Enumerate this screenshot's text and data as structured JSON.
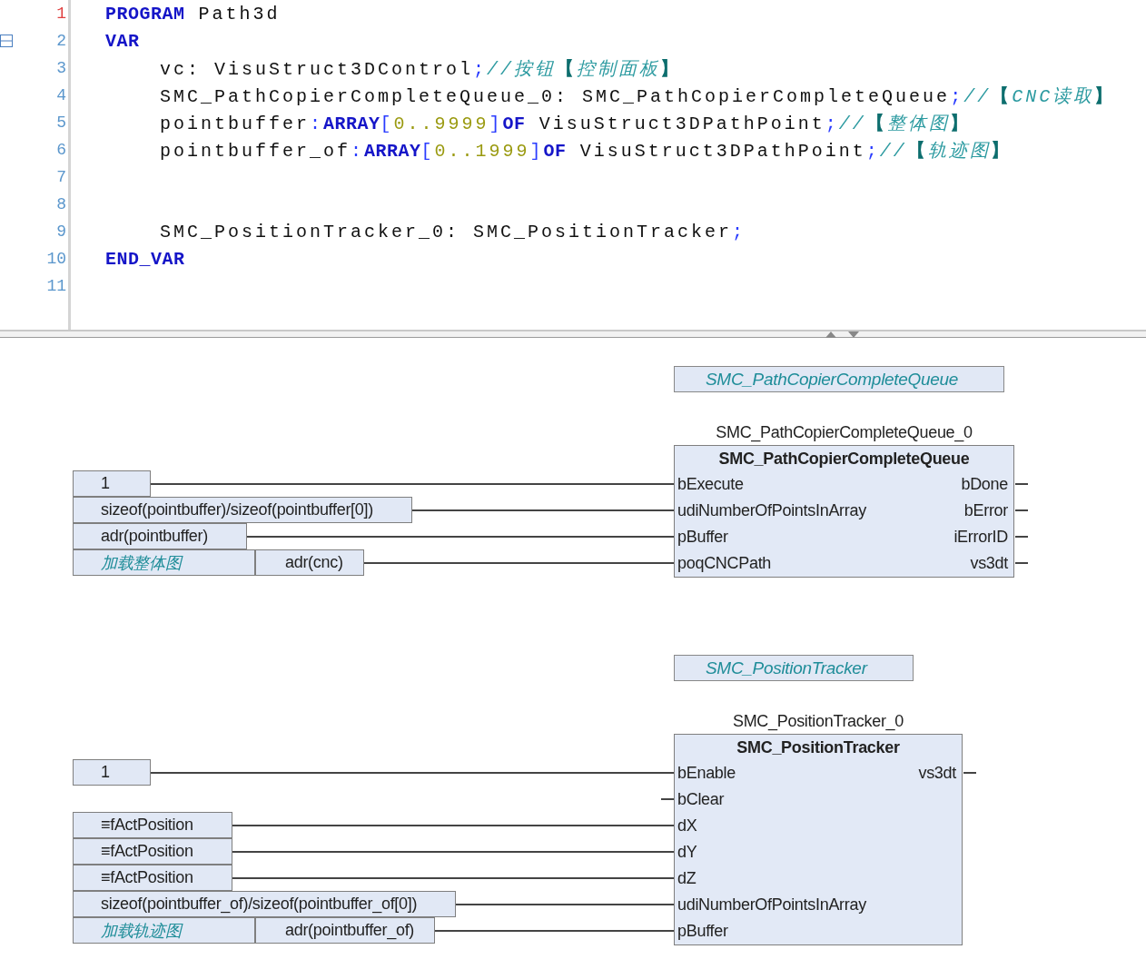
{
  "editor": {
    "lines": [
      {
        "number": "1",
        "current": true,
        "tokens": [
          {
            "kind": "keyword",
            "text": "PROGRAM"
          },
          {
            "kind": "text",
            "text": " Path3d"
          }
        ]
      },
      {
        "number": "2",
        "current": false,
        "expanded": true,
        "tokens": [
          {
            "kind": "keyword",
            "text": "VAR"
          }
        ],
        "children": [
          {
            "number": "3",
            "current": false,
            "tokens": [
              {
                "kind": "text",
                "text": "vc: VisuStruct3DControl"
              },
              {
                "kind": "op",
                "text": ";"
              },
              {
                "kind": "comment",
                "text": "//按钮"
              },
              {
                "kind": "mark",
                "text": "【"
              },
              {
                "kind": "comment",
                "text": "控制面板"
              },
              {
                "kind": "mark",
                "text": "】"
              }
            ]
          },
          {
            "number": "4",
            "current": false,
            "tokens": [
              {
                "kind": "text",
                "text": "SMC_PathCopierCompleteQueue_0: SMC_PathCopierCompleteQueue"
              },
              {
                "kind": "op",
                "text": ";"
              },
              {
                "kind": "comment",
                "text": "//"
              },
              {
                "kind": "mark",
                "text": "【"
              },
              {
                "kind": "comment",
                "text": "CNC读取"
              },
              {
                "kind": "mark",
                "text": "】"
              }
            ]
          },
          {
            "number": "5",
            "current": false,
            "tokens": [
              {
                "kind": "text",
                "text": "pointbuffer"
              },
              {
                "kind": "op",
                "text": ":"
              },
              {
                "kind": "keyword",
                "text": "ARRAY"
              },
              {
                "kind": "op",
                "text": "["
              },
              {
                "kind": "number",
                "text": "0..9999"
              },
              {
                "kind": "op",
                "text": "]"
              },
              {
                "kind": "keyword",
                "text": "OF"
              },
              {
                "kind": "text",
                "text": " VisuStruct3DPathPoint"
              },
              {
                "kind": "op",
                "text": ";"
              },
              {
                "kind": "comment",
                "text": "//"
              },
              {
                "kind": "mark",
                "text": "【"
              },
              {
                "kind": "comment",
                "text": "整体图"
              },
              {
                "kind": "mark",
                "text": "】"
              }
            ]
          },
          {
            "number": "6",
            "current": false,
            "tokens": [
              {
                "kind": "text",
                "text": "pointbuffer_of"
              },
              {
                "kind": "op",
                "text": ":"
              },
              {
                "kind": "keyword",
                "text": "ARRAY"
              },
              {
                "kind": "op",
                "text": "["
              },
              {
                "kind": "number",
                "text": "0..1999"
              },
              {
                "kind": "op",
                "text": "]"
              },
              {
                "kind": "keyword",
                "text": "OF"
              },
              {
                "kind": "text",
                "text": " VisuStruct3DPathPoint"
              },
              {
                "kind": "op",
                "text": ";"
              },
              {
                "kind": "comment",
                "text": "//"
              },
              {
                "kind": "mark",
                "text": "【"
              },
              {
                "kind": "comment",
                "text": "轨迹图"
              },
              {
                "kind": "mark",
                "text": "】"
              }
            ]
          },
          {
            "number": "7",
            "current": false
          },
          {
            "number": "8",
            "current": false
          },
          {
            "number": "9",
            "current": false,
            "tokens": [
              {
                "kind": "text",
                "text": "SMC_PositionTracker_0: SMC_PositionTracker"
              },
              {
                "kind": "op",
                "text": ";"
              }
            ]
          }
        ]
      },
      {
        "number": "10",
        "current": false,
        "tokens": [
          {
            "kind": "keyword",
            "text": "END_VAR"
          }
        ]
      },
      {
        "number": "11",
        "current": false
      }
    ]
  },
  "diagram": {
    "blocks": [
      {
        "type_label": "SMC_PathCopierCompleteQueue",
        "instance": "SMC_PathCopierCompleteQueue_0",
        "title": "SMC_PathCopierCompleteQueue",
        "inputs": [
          {
            "pin": "bExecute",
            "sources": [
              {
                "kind": "value",
                "text": "1"
              }
            ]
          },
          {
            "pin": "udiNumberOfPointsInArray",
            "sources": [
              {
                "kind": "value",
                "text": "sizeof(pointbuffer)/sizeof(pointbuffer[0])"
              }
            ]
          },
          {
            "pin": "pBuffer",
            "sources": [
              {
                "kind": "value",
                "text": "adr(pointbuffer)"
              }
            ]
          },
          {
            "pin": "poqCNCPath",
            "sources": [
              {
                "kind": "label",
                "text": "加载整体图"
              },
              {
                "kind": "value",
                "text": "adr(cnc)"
              }
            ]
          }
        ],
        "outputs": [
          "bDone",
          "bError",
          "iErrorID",
          "vs3dt"
        ]
      },
      {
        "type_label": "SMC_PositionTracker",
        "instance": "SMC_PositionTracker_0",
        "title": "SMC_PositionTracker",
        "inputs": [
          {
            "pin": "bEnable",
            "sources": [
              {
                "kind": "value",
                "text": "1"
              }
            ]
          },
          {
            "pin": "bClear"
          },
          {
            "pin": "dX",
            "sources": [
              {
                "kind": "value",
                "text": "≡fActPosition"
              }
            ]
          },
          {
            "pin": "dY",
            "sources": [
              {
                "kind": "value",
                "text": "≡fActPosition"
              }
            ]
          },
          {
            "pin": "dZ",
            "sources": [
              {
                "kind": "value",
                "text": "≡fActPosition"
              }
            ]
          },
          {
            "pin": "udiNumberOfPointsInArray",
            "sources": [
              {
                "kind": "value",
                "text": "sizeof(pointbuffer_of)/sizeof(pointbuffer_of[0])"
              }
            ]
          },
          {
            "pin": "pBuffer",
            "sources": [
              {
                "kind": "label",
                "text": "加载轨迹图"
              },
              {
                "kind": "value",
                "text": "adr(pointbuffer_of)"
              }
            ]
          }
        ],
        "outputs": [
          "vs3dt"
        ]
      }
    ]
  }
}
